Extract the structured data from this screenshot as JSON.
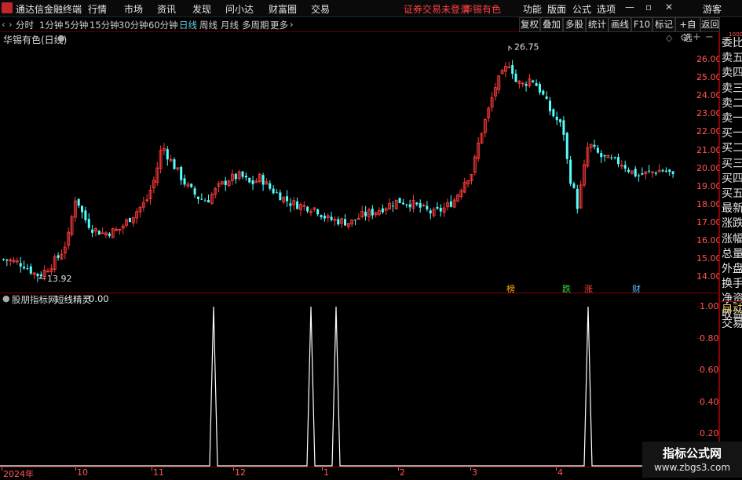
{
  "menubar": {
    "app_title": "通达信金融终端",
    "menus": [
      "行情",
      "市场",
      "资讯",
      "发现",
      "问小达",
      "财富圈",
      "交易"
    ],
    "login_notice": "证券交易未登录",
    "stock_name": "华锡有色",
    "right_menus": [
      "功能",
      "版面",
      "公式",
      "选项"
    ],
    "guest": "游客"
  },
  "periods": {
    "items": [
      "分时",
      "1分钟",
      "5分钟",
      "15分钟",
      "30分钟",
      "60分钟",
      "日线",
      "周线",
      "月线",
      "多周期",
      "更多"
    ],
    "active": "日线"
  },
  "toolbar": [
    "复权",
    "叠加",
    "多股",
    "统计",
    "画线",
    "F10",
    "标记",
    "+自选",
    "返回"
  ],
  "main_chart": {
    "title": "华锡有色(日线)",
    "high_label": "26.75",
    "low_label": "13.92",
    "yaxis_ticks": [
      "26.00",
      "25.00",
      "24.00",
      "23.00",
      "22.00",
      "21.00",
      "20.00",
      "19.00",
      "18.00",
      "17.00",
      "16.00",
      "15.00",
      "14.00"
    ],
    "markers": [
      {
        "text": "榜",
        "color": "#ffb000"
      },
      {
        "text": "跌",
        "color": "#30e030"
      },
      {
        "text": "涨",
        "color": "#ff4040"
      },
      {
        "text": "财",
        "color": "#5cb8ff"
      }
    ]
  },
  "indicator": {
    "title": "股朋指标网",
    "name": "短线精灵",
    "value": "0.00",
    "yaxis_ticks": [
      "1.00",
      "0.80",
      "0.60",
      "0.40",
      "0.20"
    ]
  },
  "xaxis": [
    "2024年",
    "10",
    "11",
    "12",
    "1",
    "2",
    "3",
    "4"
  ],
  "right_panel": [
    "委比",
    "卖五",
    "卖四",
    "卖三",
    "卖二",
    "卖一",
    "买一",
    "买二",
    "买三",
    "买四",
    "买五",
    "最新",
    "涨跌",
    "涨幅",
    "总量",
    "外盘",
    "换手",
    "净资",
    "收益"
  ],
  "right_panel_tabs": [
    "自动",
    "交易"
  ],
  "watermark": {
    "line1": "指标公式网",
    "line2": "www.zbgs3.com"
  },
  "colors": {
    "up": "#ff3b3b",
    "down": "#54ffff",
    "grid": "#8a0000",
    "signal": "#ffffff"
  }
}
